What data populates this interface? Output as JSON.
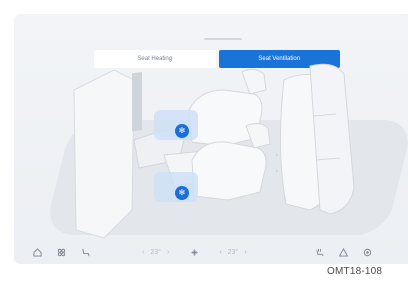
{
  "tabs": [
    {
      "label": "Seat Heating",
      "active": false
    },
    {
      "label": "Seat Ventilation",
      "active": true
    }
  ],
  "seats": {
    "driver_vent_icon": "fan-icon",
    "passenger_vent_icon": "fan-icon"
  },
  "bottom_bar": {
    "home_icon": "home-icon",
    "apps_icon": "grid-icon",
    "seat_icon": "seat-icon",
    "left_temp": {
      "prev": "‹",
      "value": "23°",
      "next": "›"
    },
    "fan_icon": "fan-icon",
    "right_temp": {
      "prev": "‹",
      "value": "23°",
      "next": "›"
    },
    "heated_seat_icon": "heated-seat-icon",
    "hazard_icon": "hazard-icon",
    "settings_icon": "settings-icon"
  },
  "caption": "OMT18-108",
  "colors": {
    "accent": "#1a73d9",
    "background": "#eff2f5",
    "tab_inactive": "#ffffff"
  }
}
